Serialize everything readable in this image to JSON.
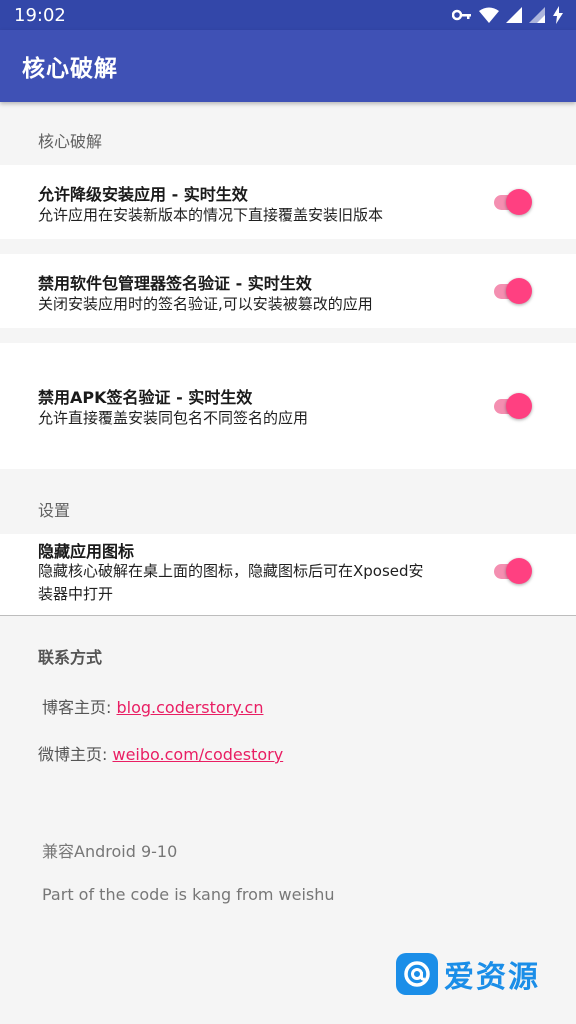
{
  "status_bar": {
    "time": "19:02"
  },
  "app_bar": {
    "title": "核心破解"
  },
  "sections": {
    "core": "核心破解",
    "settings": "设置"
  },
  "prefs": [
    {
      "title": "允许降级安装应用 - 实时生效",
      "summary": "允许应用在安装新版本的情况下直接覆盖安装旧版本",
      "enabled": true
    },
    {
      "title": "禁用软件包管理器签名验证 - 实时生效",
      "summary": "关闭安装应用时的签名验证,可以安装被篡改的应用",
      "enabled": true
    },
    {
      "title": "禁用APK签名验证 - 实时生效",
      "summary": "允许直接覆盖安装同包名不同签名的应用",
      "enabled": true
    },
    {
      "title": "隐藏应用图标",
      "summary_line1": "隐藏核心破解在桌上面的图标，隐藏图标后可在Xposed安",
      "summary_line2": "装器中打开",
      "enabled": true
    }
  ],
  "contact": {
    "header": "联系方式",
    "blog_label": "博客主页: ",
    "blog_link": "blog.coderstory.cn",
    "weibo_label": "微博主页: ",
    "weibo_link": "weibo.com/codestory"
  },
  "footer": {
    "compat": "兼容Android 9-10",
    "credit": "Part of the code is kang from weishu"
  },
  "watermark": {
    "text": "爱资源"
  },
  "colors": {
    "status_bar": "#3347a9",
    "app_bar": "#3f51b5",
    "accent": "#ff4081",
    "link": "#e91e63"
  }
}
